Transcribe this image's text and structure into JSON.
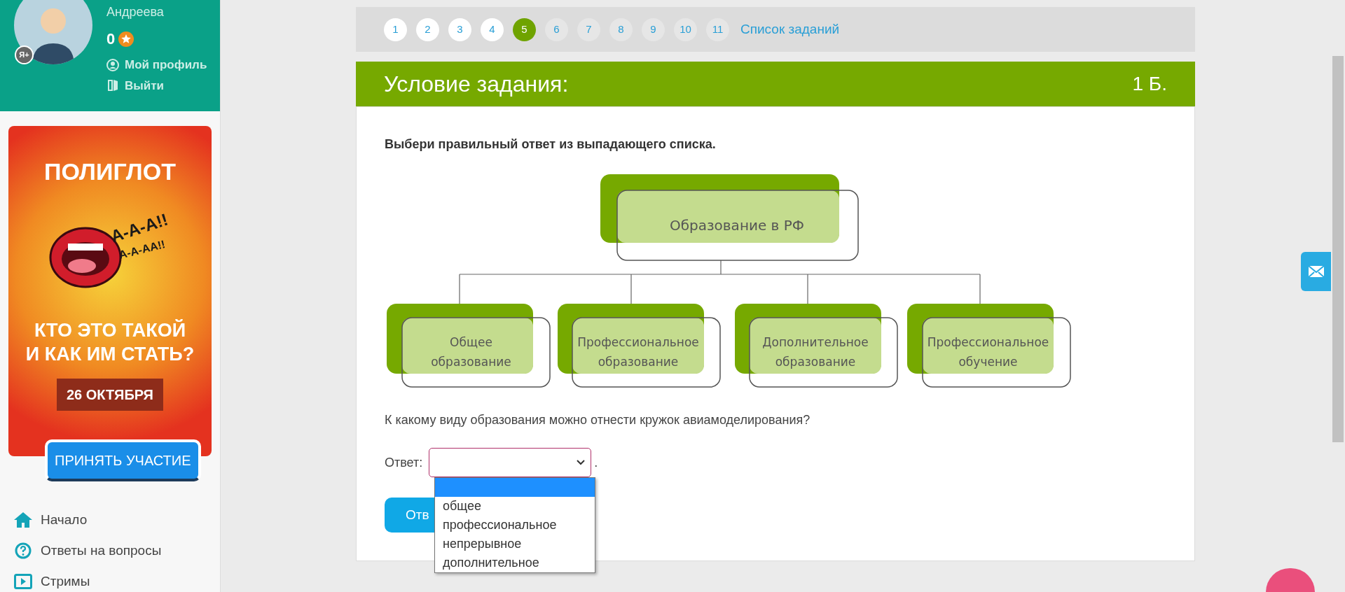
{
  "user": {
    "name": "Андреева",
    "score": "0",
    "badge": "Я+",
    "links": [
      {
        "kind": "profile",
        "label": "Мой профиль"
      },
      {
        "kind": "logout",
        "label": "Выйти"
      }
    ]
  },
  "banner": {
    "title": "ПОЛИГЛОТ",
    "shout_1": "А-А-А!!",
    "shout_2": "А-А-АА!!",
    "headline_1": "КТО ЭТО ТАКОЙ",
    "headline_2": "И КАК ИМ СТАТЬ?",
    "date": "26 ОКТЯБРЯ",
    "button": "ПРИНЯТЬ УЧАСТИЕ"
  },
  "nav": [
    {
      "kind": "home",
      "label": "Начало"
    },
    {
      "kind": "faq",
      "label": "Ответы на вопросы"
    },
    {
      "kind": "streams",
      "label": "Стримы"
    }
  ],
  "pagination": {
    "pages": [
      {
        "label": "1",
        "selected": false,
        "visited": true
      },
      {
        "label": "2",
        "selected": false,
        "visited": true
      },
      {
        "label": "3",
        "selected": false,
        "visited": true
      },
      {
        "label": "4",
        "selected": false,
        "visited": true
      },
      {
        "label": "5",
        "selected": true
      },
      {
        "label": "6",
        "selected": false,
        "visited": false
      },
      {
        "label": "7",
        "selected": false,
        "visited": false
      },
      {
        "label": "8",
        "selected": false,
        "visited": false
      },
      {
        "label": "9",
        "selected": false,
        "visited": false
      },
      {
        "label": "10",
        "selected": false,
        "visited": false
      },
      {
        "label": "11",
        "selected": false,
        "visited": false
      }
    ],
    "list_link": "Список заданий"
  },
  "task": {
    "title": "Условие задания:",
    "points": "1 Б.",
    "instruction": "Выбери правильный ответ из выпадающего списка.",
    "diagram": {
      "root": "Образование в РФ",
      "children": [
        "Общее образование",
        "Профессиональное образование",
        "Дополнительное образование",
        "Профессиональное обучение"
      ]
    },
    "question": "К какому виду образования можно отнести кружок авиамоделирования?",
    "answer_label": "Ответ:",
    "answer_suffix": ".",
    "options": [
      {
        "selected": true
      },
      {
        "label": "общее",
        "selected": false
      },
      {
        "label": "профессиональное",
        "selected": false
      },
      {
        "label": "непрерывное",
        "selected": false
      },
      {
        "label": "дополнительное",
        "selected": false
      }
    ],
    "submit": "Отв"
  }
}
